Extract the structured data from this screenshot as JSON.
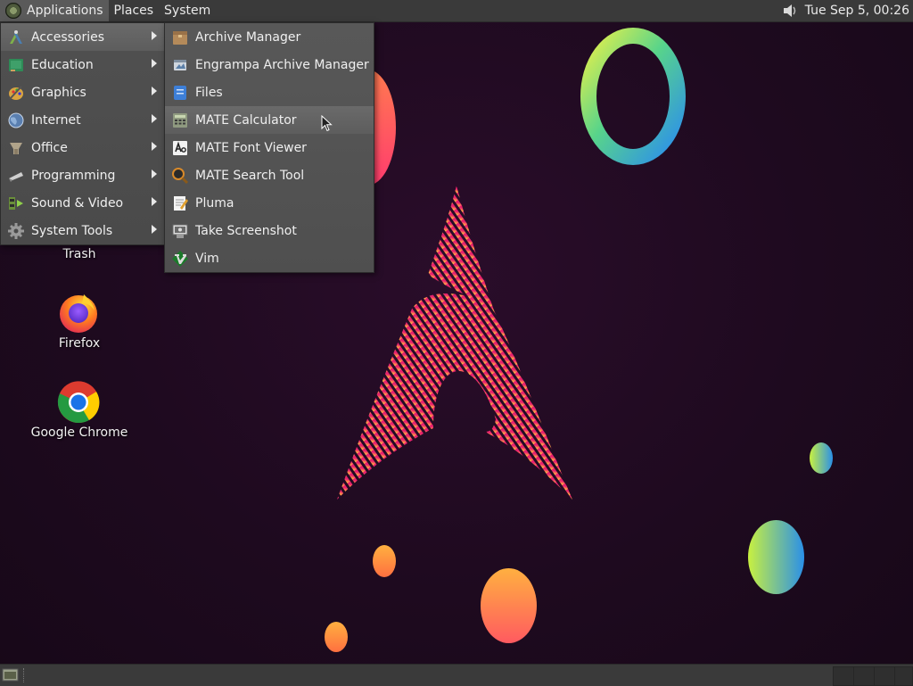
{
  "top_panel": {
    "applications": "Applications",
    "places": "Places",
    "system": "System",
    "clock": "Tue Sep  5, 00:26"
  },
  "menu": {
    "categories": [
      {
        "label": "Accessories",
        "icon": "accessories-icon"
      },
      {
        "label": "Education",
        "icon": "education-icon"
      },
      {
        "label": "Graphics",
        "icon": "graphics-icon"
      },
      {
        "label": "Internet",
        "icon": "internet-icon"
      },
      {
        "label": "Office",
        "icon": "office-icon"
      },
      {
        "label": "Programming",
        "icon": "programming-icon"
      },
      {
        "label": "Sound & Video",
        "icon": "sound-video-icon"
      },
      {
        "label": "System Tools",
        "icon": "system-tools-icon"
      }
    ],
    "accessories": [
      {
        "label": "Archive Manager",
        "icon": "archive-manager-icon"
      },
      {
        "label": "Engrampa Archive Manager",
        "icon": "engrampa-icon"
      },
      {
        "label": "Files",
        "icon": "files-icon"
      },
      {
        "label": "MATE Calculator",
        "icon": "calculator-icon"
      },
      {
        "label": "MATE Font Viewer",
        "icon": "font-viewer-icon"
      },
      {
        "label": "MATE Search Tool",
        "icon": "search-tool-icon"
      },
      {
        "label": "Pluma",
        "icon": "pluma-icon"
      },
      {
        "label": "Take Screenshot",
        "icon": "screenshot-icon"
      },
      {
        "label": "Vim",
        "icon": "vim-icon"
      }
    ],
    "hovered_item": "MATE Calculator"
  },
  "desktop": {
    "icons": [
      {
        "label": "Trash"
      },
      {
        "label": "Firefox"
      },
      {
        "label": "Google Chrome"
      }
    ]
  },
  "colors": {
    "panel": "#3a3a3a",
    "menu": "#4f4f4f",
    "wallpaper": "#1e0a1f",
    "accent_pink": "#e6246e"
  }
}
